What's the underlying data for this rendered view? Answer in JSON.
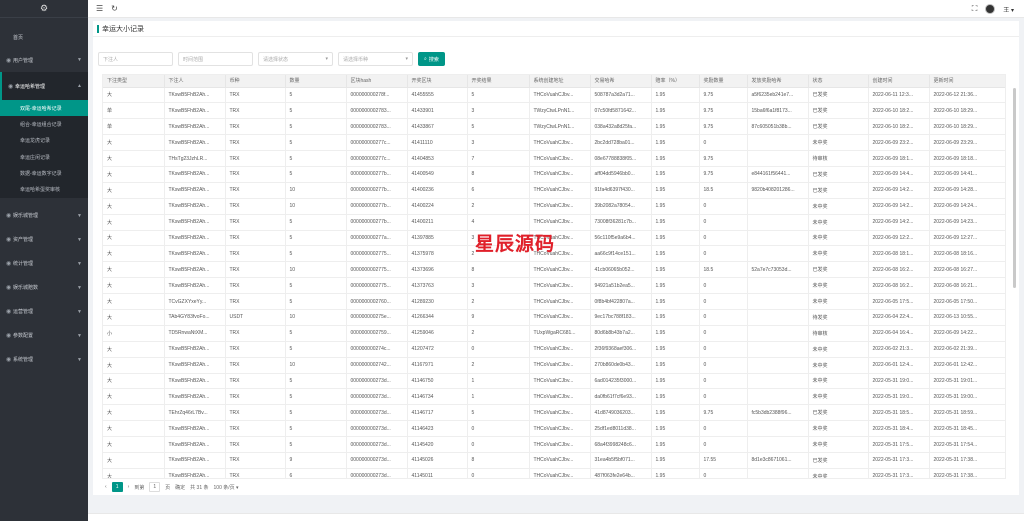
{
  "colors": {
    "accent": "#009688",
    "sidebar": "#2d3138"
  },
  "sidebar": {
    "logo_icon": "gear-icon",
    "items": [
      {
        "label": "首页"
      },
      {
        "label": "用户管理"
      },
      {
        "label": "幸运哈希管理"
      },
      {
        "label": "娱乐城管理"
      },
      {
        "label": "资产管理"
      },
      {
        "label": "统计管理"
      },
      {
        "label": "娱乐城赔数"
      },
      {
        "label": "运营管理"
      },
      {
        "label": "参数配置"
      },
      {
        "label": "系统管理"
      }
    ],
    "subitems": [
      {
        "label": "双尾-幸运哈希记录"
      },
      {
        "label": "组合-幸运组合记录"
      },
      {
        "label": "幸运龙虎记录"
      },
      {
        "label": "幸运庄闲记录"
      },
      {
        "label": "数据-幸运数字记录"
      },
      {
        "label": "幸运哈希蛋奖审核"
      }
    ]
  },
  "topbar": {
    "user": "王"
  },
  "page": {
    "title": "幸运大小记录"
  },
  "filters": {
    "player_placeholder": "下注人",
    "time_placeholder": "时间范围",
    "status_placeholder": "请选择状态",
    "currency_placeholder": "请选择币种",
    "search_label": "搜索"
  },
  "table": {
    "columns": [
      "下注类型",
      "下注人",
      "币种",
      "数量",
      "区块hash",
      "开奖区块",
      "开奖结果",
      "系统创建地址",
      "交易哈希",
      "赔率（%）",
      "奖励数量",
      "发放奖励哈希",
      "状态",
      "创建时间",
      "更新时间"
    ],
    "rows": [
      [
        "大",
        "TKswB5FhB2Ah...",
        "TRX",
        "5",
        "000000000278f...",
        "41455555",
        "5",
        "THCoVuahCJbv...",
        "508787a3d2a71...",
        "1.95",
        "9.75",
        "a5f6235eb241e7...",
        "已发奖",
        "2022-06-11 12:3...",
        "2022-06-12 21:36..."
      ],
      [
        "单",
        "TKswB5FhB2Ah...",
        "TRX",
        "5",
        "0000000002783...",
        "41433901",
        "3",
        "TWzyCtwLPnN1...",
        "07c50fd5871642...",
        "1.95",
        "9.75",
        "15ba6f6a1f8173...",
        "已发奖",
        "2022-06-10 18:2...",
        "2022-06-10 18:29..."
      ],
      [
        "单",
        "TKswB5FhB2Ah...",
        "TRX",
        "5",
        "0000000002783...",
        "41433867",
        "5",
        "TWzyCtwLPnN1...",
        "038a432a8d25fa...",
        "1.95",
        "9.75",
        "87c605051b38b...",
        "已发奖",
        "2022-06-10 18:2...",
        "2022-06-10 18:29..."
      ],
      [
        "大",
        "TKswB5FhB2Ah...",
        "TRX",
        "5",
        "000000000277c...",
        "41411110",
        "3",
        "THCoVuahCJbv...",
        "2bc2dd728ba01...",
        "1.95",
        "0",
        "",
        "未中奖",
        "2022-06-09 23:2...",
        "2022-06-09 23:29..."
      ],
      [
        "大",
        "THsTg23JzhLR...",
        "TRX",
        "5",
        "000000000277c...",
        "41404853",
        "7",
        "THCoVuahCJbv...",
        "08e67788838f05...",
        "1.95",
        "9.75",
        "",
        "待审核",
        "2022-06-09 18:1...",
        "2022-06-09 18:18..."
      ],
      [
        "大",
        "TKswB5FhB2Ah...",
        "TRX",
        "5",
        "000000000277b...",
        "41400549",
        "8",
        "THCoVuahCJbv...",
        "aff04dd5946bb0...",
        "1.95",
        "9.75",
        "e844161f56441...",
        "已发奖",
        "2022-06-09 14:4...",
        "2022-06-09 14:41..."
      ],
      [
        "大",
        "TKswB5FhB2Ah...",
        "TRX",
        "10",
        "000000000277b...",
        "41400236",
        "6",
        "THCoVuahCJbv...",
        "91fa4d6397f430...",
        "1.95",
        "18.5",
        "9820b408201286...",
        "已发奖",
        "2022-06-09 14:2...",
        "2022-06-09 14:28..."
      ],
      [
        "大",
        "TKswB5FhB2Ah...",
        "TRX",
        "10",
        "000000000277b...",
        "41400224",
        "2",
        "THCoVuahCJbv...",
        "39b2082a78054...",
        "1.95",
        "0",
        "",
        "未中奖",
        "2022-06-09 14:2...",
        "2022-06-09 14:24..."
      ],
      [
        "大",
        "TKswB5FhB2Ah...",
        "TRX",
        "5",
        "000000000277b...",
        "41400211",
        "4",
        "THCoVuahCJbv...",
        "73008f36281c7b...",
        "1.95",
        "0",
        "",
        "未中奖",
        "2022-06-09 14:2...",
        "2022-06-09 14:23..."
      ],
      [
        "大",
        "TKswB5FhB2Ah...",
        "TRX",
        "5",
        "000000000277a...",
        "41397885",
        "3",
        "THCoVuahCJbv...",
        "56c110f5e9a6b4...",
        "1.95",
        "0",
        "",
        "未中奖",
        "2022-06-09 12:2...",
        "2022-06-09 12:27..."
      ],
      [
        "大",
        "TKswB5FhB2Ah...",
        "TRX",
        "5",
        "0000000002775...",
        "41375978",
        "2",
        "THCoVuahCJbv...",
        "aa66c9f14ce151...",
        "1.95",
        "0",
        "",
        "未中奖",
        "2022-06-08 18:1...",
        "2022-06-08 18:16..."
      ],
      [
        "大",
        "TKswB5FhB2Ah...",
        "TRX",
        "10",
        "0000000002775...",
        "41373696",
        "8",
        "THCoVuahCJbv...",
        "41cb06065b052...",
        "1.95",
        "18.5",
        "52a7e7c73053d...",
        "已发奖",
        "2022-06-08 16:2...",
        "2022-06-08 16:27..."
      ],
      [
        "大",
        "TKswB5FhB2Ah...",
        "TRX",
        "5",
        "0000000002775...",
        "41373763",
        "3",
        "THCoVuahCJbv...",
        "94921a51b2ea5...",
        "1.95",
        "0",
        "",
        "未中奖",
        "2022-06-08 16:2...",
        "2022-06-08 16:21..."
      ],
      [
        "大",
        "TCvGZXYxeYy...",
        "TRX",
        "5",
        "0000000002760...",
        "41289230",
        "2",
        "THCoVuahCJbv...",
        "0f8b4bf422807a...",
        "1.95",
        "0",
        "",
        "未中奖",
        "2022-06-05 17:5...",
        "2022-06-05 17:50..."
      ],
      [
        "大",
        "TAb4GY83fvoFo...",
        "USDT",
        "10",
        "000000000275e...",
        "41266344",
        "9",
        "THCoVuahCJbv...",
        "9ec17bc788f183...",
        "1.95",
        "0",
        "",
        "待发奖",
        "2022-06-04 22:4...",
        "2022-06-13 10:55..."
      ],
      [
        "小",
        "TD5RnwaNtXM...",
        "TRX",
        "5",
        "0000000002759...",
        "41259046",
        "2",
        "TUxpWgaRC681...",
        "80d6b8b43b7a2...",
        "1.95",
        "0",
        "",
        "待审核",
        "2022-06-04 16:4...",
        "2022-06-09 14:22..."
      ],
      [
        "大",
        "TKswB5FhB2Ah...",
        "TRX",
        "5",
        "000000000274c...",
        "41207472",
        "0",
        "THCoVuahCJbv...",
        "2f36f9368aef306...",
        "1.95",
        "0",
        "",
        "未中奖",
        "2022-06-02 21:3...",
        "2022-06-02 21:39..."
      ],
      [
        "大",
        "TKswB5FhB2Ah...",
        "TRX",
        "10",
        "0000000002742...",
        "41167971",
        "2",
        "THCoVuahCJbv...",
        "270b860de0b43...",
        "1.95",
        "0",
        "",
        "未中奖",
        "2022-06-01 12:4...",
        "2022-06-01 12:42..."
      ],
      [
        "大",
        "TKswB5FhB2Ah...",
        "TRX",
        "5",
        "000000000273d...",
        "41146750",
        "1",
        "THCoVuahCJbv...",
        "6ad014235f3000...",
        "1.95",
        "0",
        "",
        "未中奖",
        "2022-05-31 19:0...",
        "2022-05-31 19:01..."
      ],
      [
        "大",
        "TKswB5FhB2Ah...",
        "TRX",
        "5",
        "000000000273d...",
        "41146734",
        "1",
        "THCoVuahCJbv...",
        "da0fb61f7cf6e93...",
        "1.95",
        "0",
        "",
        "未中奖",
        "2022-05-31 19:0...",
        "2022-05-31 19:00..."
      ],
      [
        "大",
        "TEhrZq46rL7Bv...",
        "TRX",
        "5",
        "000000000273d...",
        "41146717",
        "5",
        "THCoVuahCJbv...",
        "41d8749036203...",
        "1.95",
        "9.75",
        "fc5b3db2388f96...",
        "已发奖",
        "2022-05-31 18:5...",
        "2022-05-31 18:59..."
      ],
      [
        "大",
        "TKswB5FhB2Ah...",
        "TRX",
        "5",
        "000000000273d...",
        "41146423",
        "0",
        "THCoVuahCJbv...",
        "25df1ed8011d38...",
        "1.95",
        "0",
        "",
        "未中奖",
        "2022-05-31 18:4...",
        "2022-05-31 18:45..."
      ],
      [
        "大",
        "TKswB5FhB2Ah...",
        "TRX",
        "5",
        "000000000273d...",
        "41145420",
        "0",
        "THCoVuahCJbv...",
        "68a4f3998248c6...",
        "1.95",
        "0",
        "",
        "未中奖",
        "2022-05-31 17:5...",
        "2022-05-31 17:54..."
      ],
      [
        "大",
        "TKswB5FhB2Ah...",
        "TRX",
        "9",
        "000000000273d...",
        "41145026",
        "8",
        "THCoVuahCJbv...",
        "31ea4b5f5bf071...",
        "1.95",
        "17.55",
        "8d1e3c8671061...",
        "已发奖",
        "2022-05-31 17:3...",
        "2022-05-31 17:38..."
      ],
      [
        "大",
        "TKswB5FhB2Ah...",
        "TRX",
        "6",
        "000000000273d...",
        "41145011",
        "0",
        "THCoVuahCJbv...",
        "487f063fe2e64b...",
        "1.95",
        "0",
        "",
        "未中奖",
        "2022-05-31 17:3...",
        "2022-05-31 17:38..."
      ]
    ]
  },
  "pager": {
    "current": "1",
    "goto_label": "到第",
    "page_input": "1",
    "page_unit": "页",
    "confirm_label": "确定",
    "total": "共 31 条",
    "size": "100 条/页"
  },
  "watermark": "星辰源码"
}
